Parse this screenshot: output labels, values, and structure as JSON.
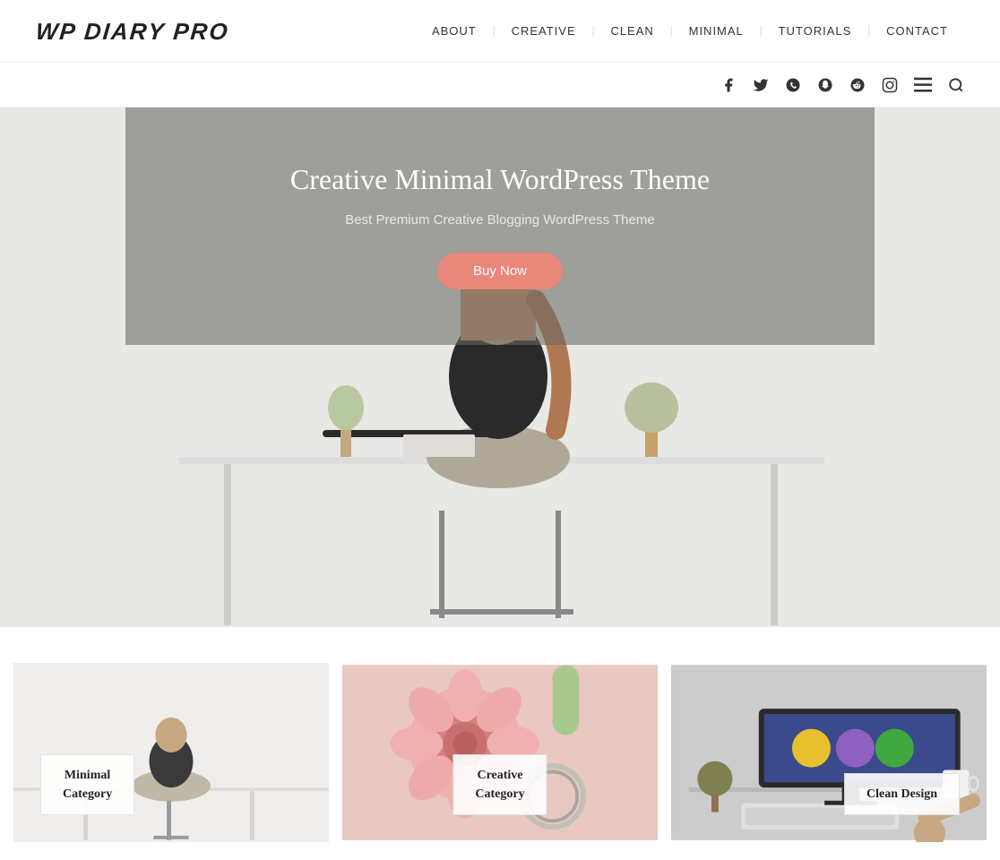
{
  "header": {
    "logo": "WP DIARY PRO",
    "nav": [
      {
        "label": "ABOUT",
        "id": "about"
      },
      {
        "label": "CREATIVE",
        "id": "creative"
      },
      {
        "label": "CLEAN",
        "id": "clean"
      },
      {
        "label": "MINIMAL",
        "id": "minimal"
      },
      {
        "label": "TUTORIALS",
        "id": "tutorials"
      },
      {
        "label": "CONTACT",
        "id": "contact"
      }
    ]
  },
  "social": {
    "icons": [
      {
        "name": "facebook-icon",
        "glyph": "f"
      },
      {
        "name": "twitter-icon",
        "glyph": "t"
      },
      {
        "name": "whatsapp-icon",
        "glyph": "w"
      },
      {
        "name": "snapchat-icon",
        "glyph": "s"
      },
      {
        "name": "reddit-icon",
        "glyph": "r"
      },
      {
        "name": "instagram-icon",
        "glyph": "i"
      },
      {
        "name": "menu-icon",
        "glyph": "≡"
      },
      {
        "name": "search-icon",
        "glyph": "⌕"
      }
    ]
  },
  "hero": {
    "title": "Creative Minimal WordPress Theme",
    "subtitle": "Best Premium Creative Blogging WordPress Theme",
    "button_label": "Buy Now"
  },
  "cards": [
    {
      "id": "minimal",
      "label_line1": "Minimal",
      "label_line2": "Category",
      "theme": "minimal"
    },
    {
      "id": "creative",
      "label_line1": "Creative",
      "label_line2": "Category",
      "theme": "creative"
    },
    {
      "id": "clean",
      "label_line1": "Clean Design",
      "label_line2": "",
      "theme": "clean"
    }
  ]
}
